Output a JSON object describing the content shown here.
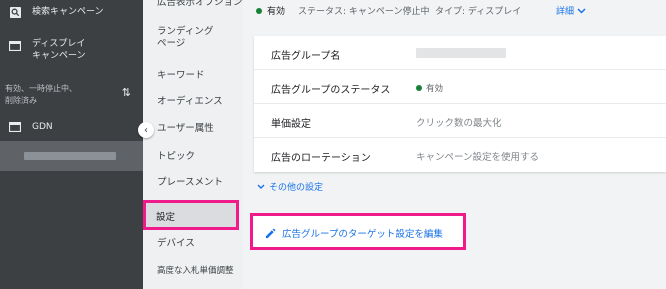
{
  "sidebar": {
    "search_campaign": "検索キャンペーン",
    "display_campaign": "ディスプレイ\nキャンペーン",
    "filter_label": "有効、一時停止中、\n削除済み",
    "gdn_label": "GDN"
  },
  "menu": {
    "items": [
      {
        "label": "広告表示オプション"
      },
      {
        "label": "ランディング\nページ"
      },
      {
        "label": "キーワード"
      },
      {
        "label": "オーディエンス"
      },
      {
        "label": "ユーザー属性"
      },
      {
        "label": "トピック"
      },
      {
        "label": "プレースメント"
      },
      {
        "label": "設定"
      },
      {
        "label": "デバイス"
      },
      {
        "label": "高度な入札単価調整"
      }
    ]
  },
  "status_bar": {
    "status": "有効",
    "campaign_status": "ステータス: キャンペーン停止中",
    "type": "タイプ: ディスプレイ",
    "detail": "詳細"
  },
  "card": {
    "rows": [
      {
        "label": "広告グループ名",
        "value": ""
      },
      {
        "label": "広告グループのステータス",
        "value": "有効"
      },
      {
        "label": "単価設定",
        "value": "クリック数の最大化"
      },
      {
        "label": "広告のローテーション",
        "value": "キャンペーン設定を使用する"
      }
    ]
  },
  "more_settings": "その他の設定",
  "edit_targeting": "広告グループのターゲット設定を編集",
  "colors": {
    "sidebar_bg": "#3c4043",
    "accent_blue": "#1a73e8",
    "status_green": "#188038",
    "highlight_pink": "#f01a8a"
  }
}
